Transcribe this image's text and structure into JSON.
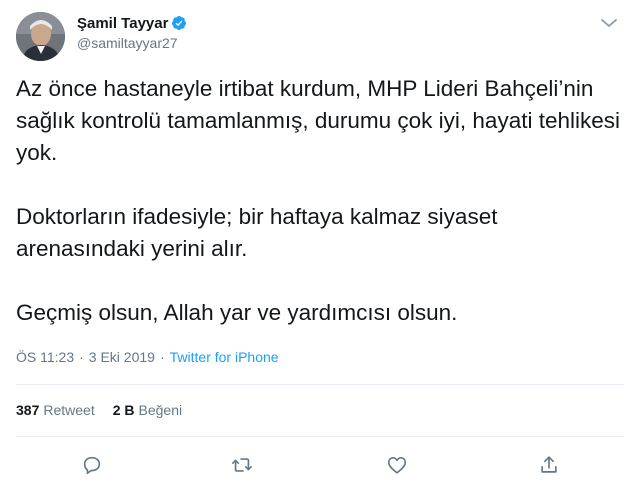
{
  "author": {
    "display_name": "Şamil Tayyar",
    "handle": "@samiltayyar27",
    "verified": true
  },
  "tweet": {
    "text": "Az önce hastaneyle irtibat kurdum, MHP Lideri Bahçeli’nin sağlık kontrolü tamamlanmış, durumu çok iyi, hayati tehlikesi yok.\n\nDoktorların ifadesiyle; bir haftaya kalmaz siyaset arenasındaki yerini alır.\n\nGeçmiş olsun, Allah yar ve yardımcısı olsun.",
    "time": "ÖS 11:23",
    "separator": "·",
    "date": "3 Eki 2019",
    "source": "Twitter for iPhone"
  },
  "stats": {
    "retweet_count": "387",
    "retweet_label": "Retweet",
    "like_count": "2 B",
    "like_label": "Beğeni"
  },
  "actions": [
    {
      "icon": "reply-icon"
    },
    {
      "icon": "retweet-icon"
    },
    {
      "icon": "like-icon"
    },
    {
      "icon": "share-icon"
    }
  ],
  "colors": {
    "text": "#14171a",
    "secondary": "#657786",
    "link": "#1da1f2",
    "verified": "#1da1f2",
    "divider": "#e6ecf0"
  }
}
